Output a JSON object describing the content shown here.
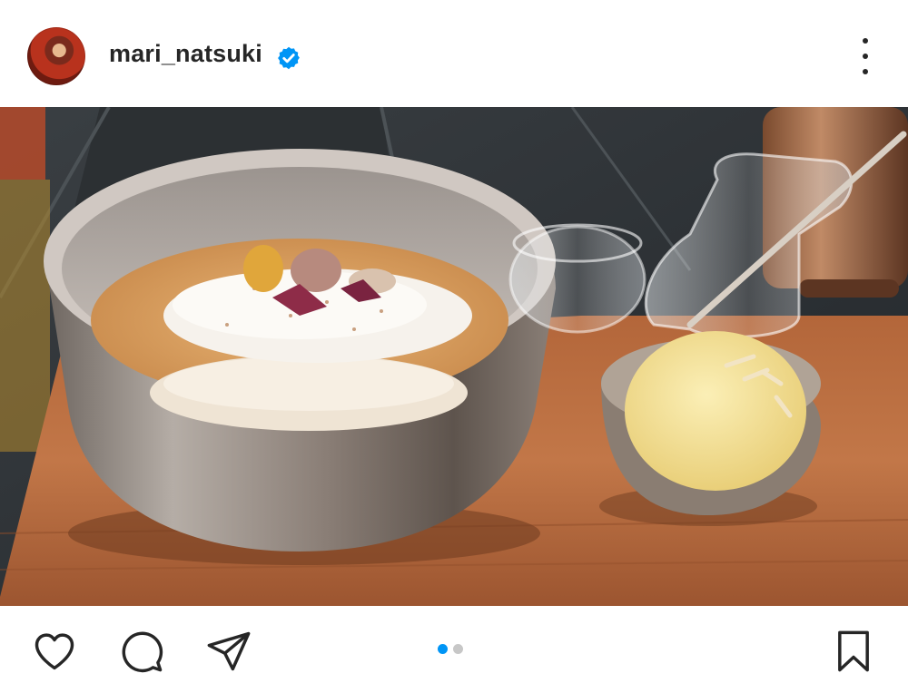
{
  "post": {
    "username": "mari_natsuki",
    "verified_icon": "verified-badge-icon",
    "more_icon": "more-options-icon",
    "avatar_icon": "profile-avatar"
  },
  "photo": {
    "subject": "dessert-photo"
  },
  "actions": {
    "like_icon": "heart-icon",
    "comment_icon": "comment-icon",
    "share_icon": "send-icon",
    "save_icon": "bookmark-icon"
  },
  "carousel": {
    "total": 2,
    "current": 1,
    "active_color": "#0095f6",
    "inactive_color": "#c7c7c7"
  },
  "colors": {
    "text": "#262626",
    "verified": "#0095f6",
    "background": "#ffffff"
  }
}
